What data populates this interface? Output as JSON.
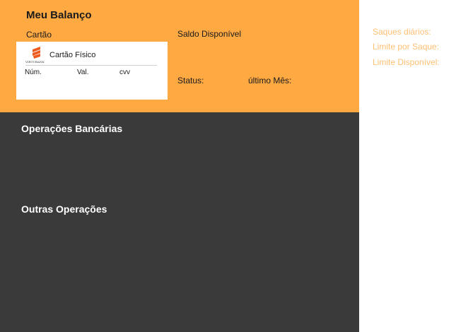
{
  "balance": {
    "title": "Meu Balanço",
    "card_label": "Cartão",
    "card": {
      "bank_name": "VIRTUBANK",
      "type": "Cartão Físico",
      "number_label": "Núm.",
      "validity_label": "Val.",
      "cvv_label": "cvv",
      "logo_icon": "virtubank-logo-icon"
    },
    "available_balance_label": "Saldo Disponível",
    "status_label": "Status:",
    "last_month_label": "último Mês:"
  },
  "operations": {
    "bank_heading": "Operações Bancárias",
    "other_heading": "Outras Operações"
  },
  "limits": {
    "daily_withdrawals_label": "Saques diários:",
    "per_withdrawal_label": "Limite por Saque:",
    "available_limit_label": "Limite Disponível:"
  },
  "colors": {
    "accent": "#ffa943",
    "dark_panel": "#3a3a3a",
    "limit_text": "#ffbf73"
  }
}
